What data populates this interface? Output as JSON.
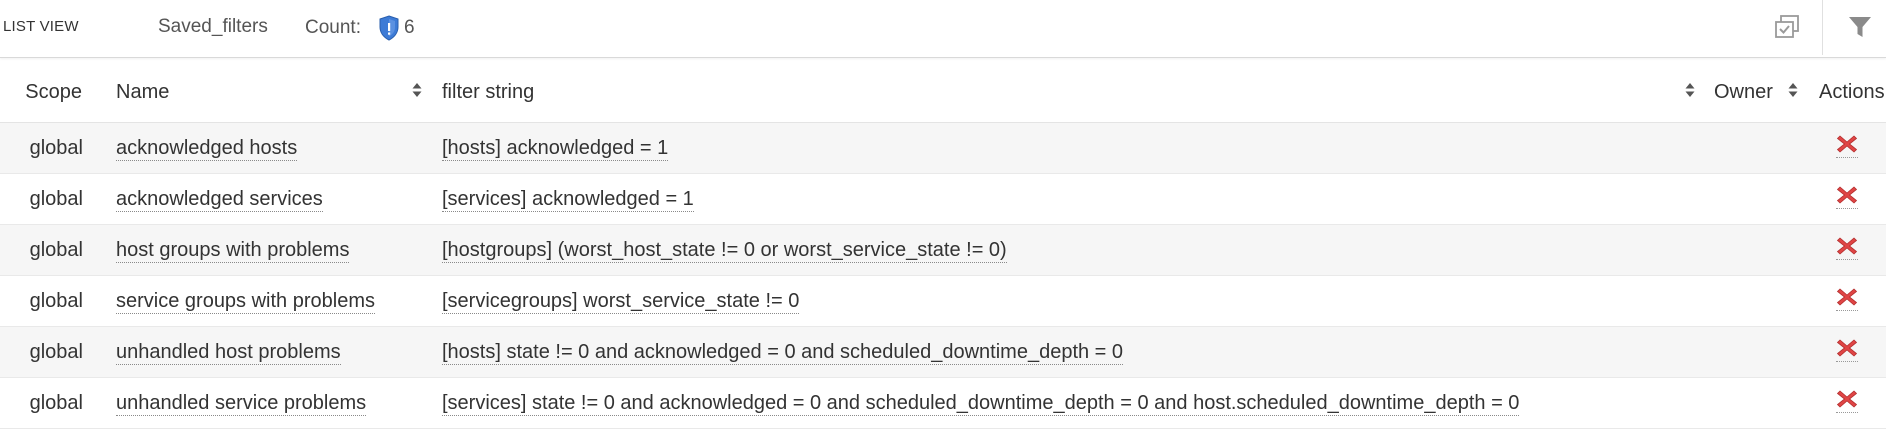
{
  "header": {
    "title": "LIST VIEW",
    "saved_filters": "Saved_filters",
    "count_label": "Count:",
    "count_value": "6",
    "icons": {
      "count": "shield-icon",
      "copy": "copy-icon",
      "filter": "filter-icon"
    },
    "shield_color": "#3d7bd6"
  },
  "table": {
    "columns": {
      "scope": "Scope",
      "name": "Name",
      "filter": "filter string",
      "owner": "Owner",
      "actions": "Actions"
    },
    "rows": [
      {
        "scope": "global",
        "name": "acknowledged hosts",
        "filter": "[hosts] acknowledged = 1",
        "owner": ""
      },
      {
        "scope": "global",
        "name": "acknowledged services",
        "filter": "[services] acknowledged = 1",
        "owner": ""
      },
      {
        "scope": "global",
        "name": "host groups with problems",
        "filter": "[hostgroups] (worst_host_state != 0 or worst_service_state != 0)",
        "owner": ""
      },
      {
        "scope": "global",
        "name": "service groups with problems",
        "filter": "[servicegroups] worst_service_state != 0",
        "owner": ""
      },
      {
        "scope": "global",
        "name": "unhandled host problems",
        "filter": "[hosts] state != 0 and acknowledged = 0 and scheduled_downtime_depth = 0",
        "owner": ""
      },
      {
        "scope": "global",
        "name": "unhandled service problems",
        "filter": "[services] state != 0 and acknowledged = 0 and scheduled_downtime_depth = 0 and host.scheduled_downtime_depth = 0",
        "owner": ""
      }
    ],
    "delete_icon": "delete-icon",
    "delete_color": "#e04545"
  }
}
